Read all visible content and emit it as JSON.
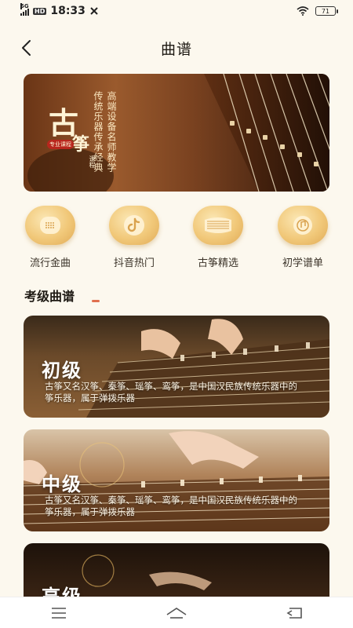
{
  "status_bar": {
    "network": "5G",
    "hd": "HD",
    "time": "18:33",
    "battery": "71",
    "icons": [
      "signal-icon",
      "hd-icon",
      "tools-icon",
      "wifi-icon",
      "battery-icon"
    ]
  },
  "nav": {
    "title": "曲谱",
    "back_icon": "chevron-left-icon"
  },
  "banner": {
    "logo_title_1": "古",
    "logo_title_2": "筝",
    "logo_seal": "专业课程",
    "logo_small": "课程",
    "lines": [
      "高端设备名师教学",
      "传统乐器传承经典"
    ]
  },
  "categories": [
    {
      "label": "流行金曲",
      "icon": "speaker-icon"
    },
    {
      "label": "抖音热门",
      "icon": "tiktok-icon"
    },
    {
      "label": "古筝精选",
      "icon": "guzheng-icon"
    },
    {
      "label": "初学谱单",
      "icon": "music-disc-icon"
    }
  ],
  "section": {
    "title": "考级曲谱"
  },
  "levels": [
    {
      "title": "初级",
      "desc": "古筝又名汉筝、秦筝、瑶筝、鸾筝，是中国汉民族传统乐器中的筝乐器，属于弹拨乐器"
    },
    {
      "title": "中级",
      "desc": "古筝又名汉筝、秦筝、瑶筝、鸾筝，是中国汉民族传统乐器中的筝乐器，属于弹拨乐器"
    },
    {
      "title": "高级",
      "desc": ""
    }
  ],
  "colors": {
    "background": "#fcf8ee",
    "accent": "#e06f4e",
    "icon_gold": "#f1c879"
  },
  "system_nav": {
    "icons": [
      "menu-icon",
      "home-icon",
      "back-icon"
    ]
  }
}
